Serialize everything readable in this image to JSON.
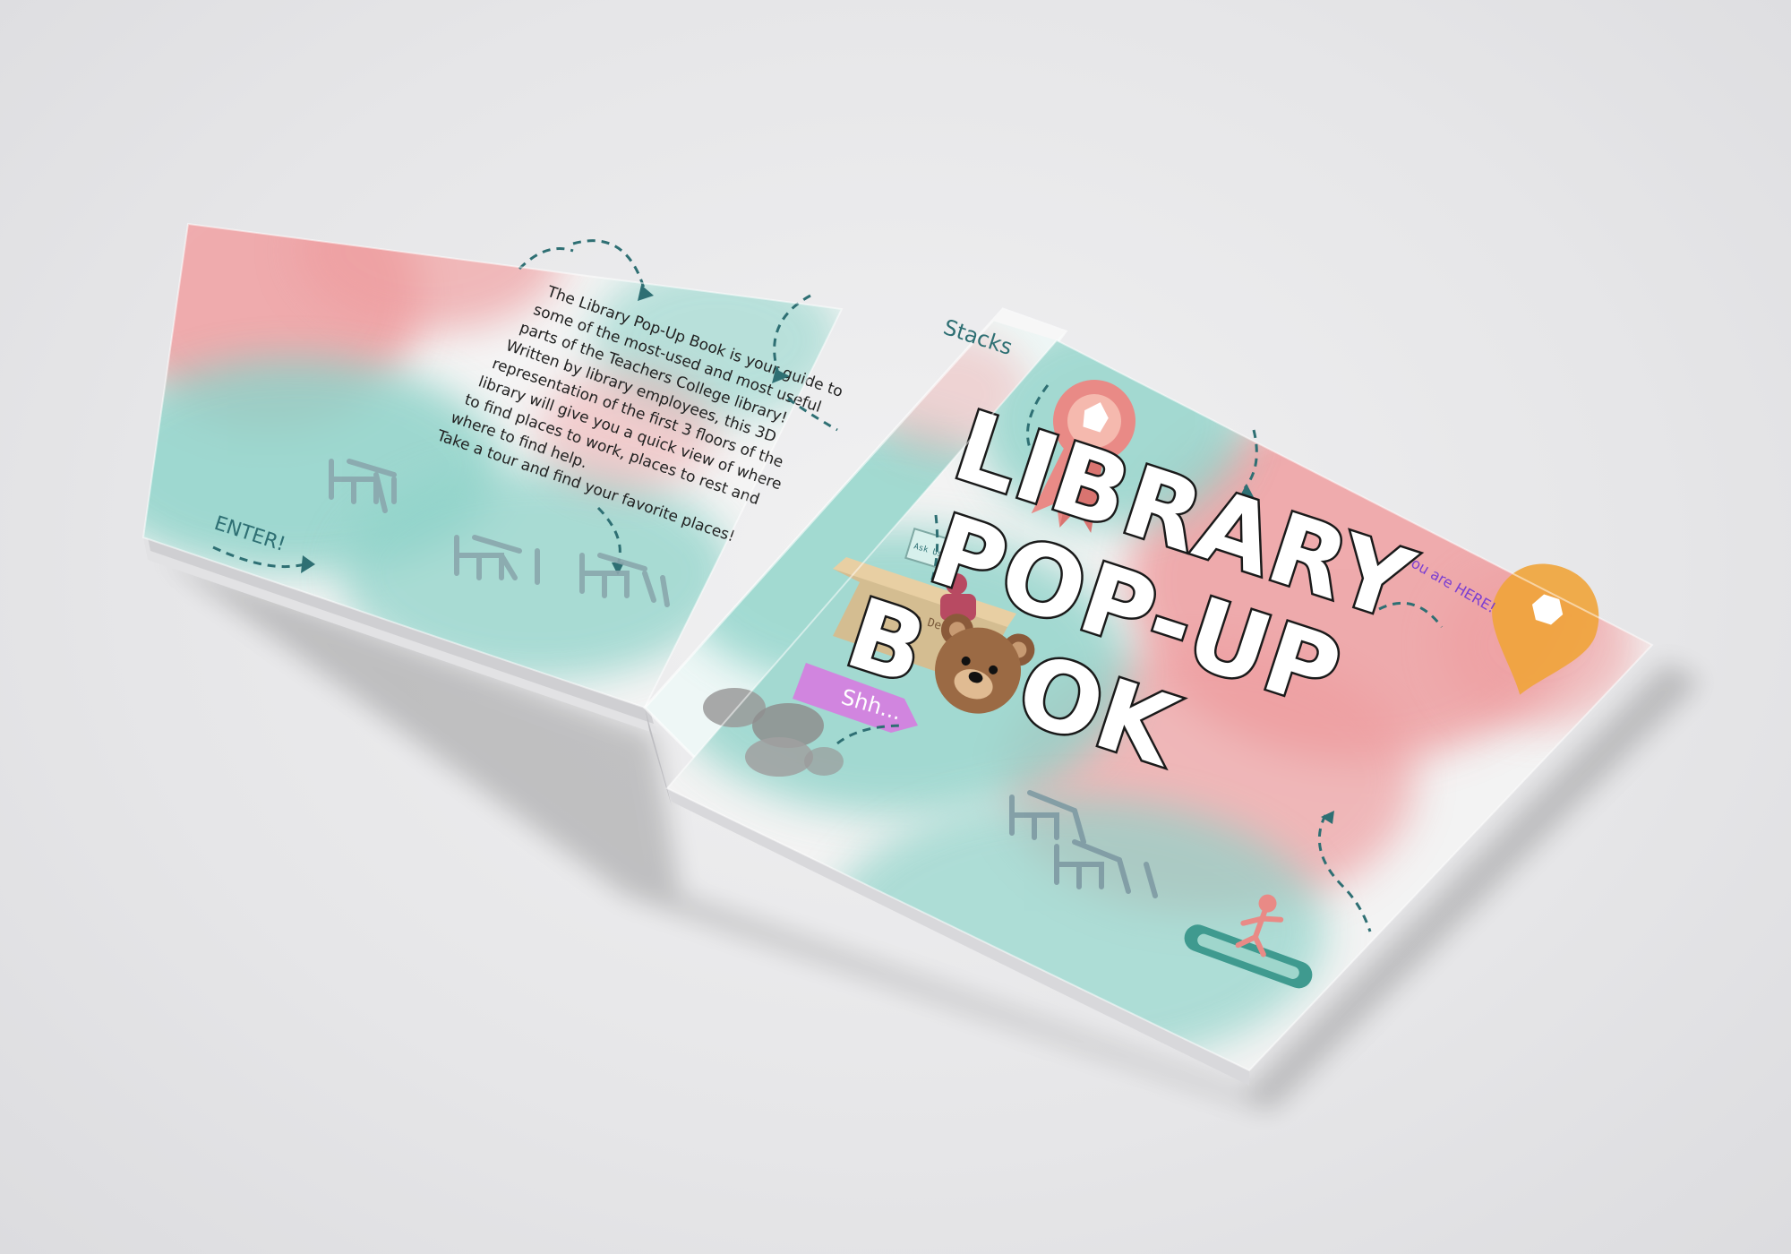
{
  "left_page": {
    "intro_lines": [
      "The Library Pop-Up Book is your guide to",
      "some of the most-used and most useful",
      "parts of the Teachers College library!",
      "Written by library employees, this 3D",
      "representation of the first 3 floors of the",
      "library will give you a quick view of where",
      "to find places to work, places to rest and",
      "where to find help.",
      "Take a tour and find your favorite places!"
    ],
    "enter_label": "ENTER!"
  },
  "spine": {
    "stacks_label": "Stacks",
    "service_desk_label": "Service Desk",
    "sign_label": "Ask Us / Help",
    "shh_label": "Shh..."
  },
  "cover": {
    "title_lines": [
      "LIBRARY",
      "POP-UP",
      "B",
      "OK"
    ],
    "you_are_here": "You are HERE!"
  },
  "colors": {
    "teal": "#8fd3c9",
    "pink": "#ee9ea0",
    "arrow": "#2e6f73",
    "purple": "#7b3fd1",
    "orange": "#f0a43a",
    "ribbon": "#e98a86"
  }
}
